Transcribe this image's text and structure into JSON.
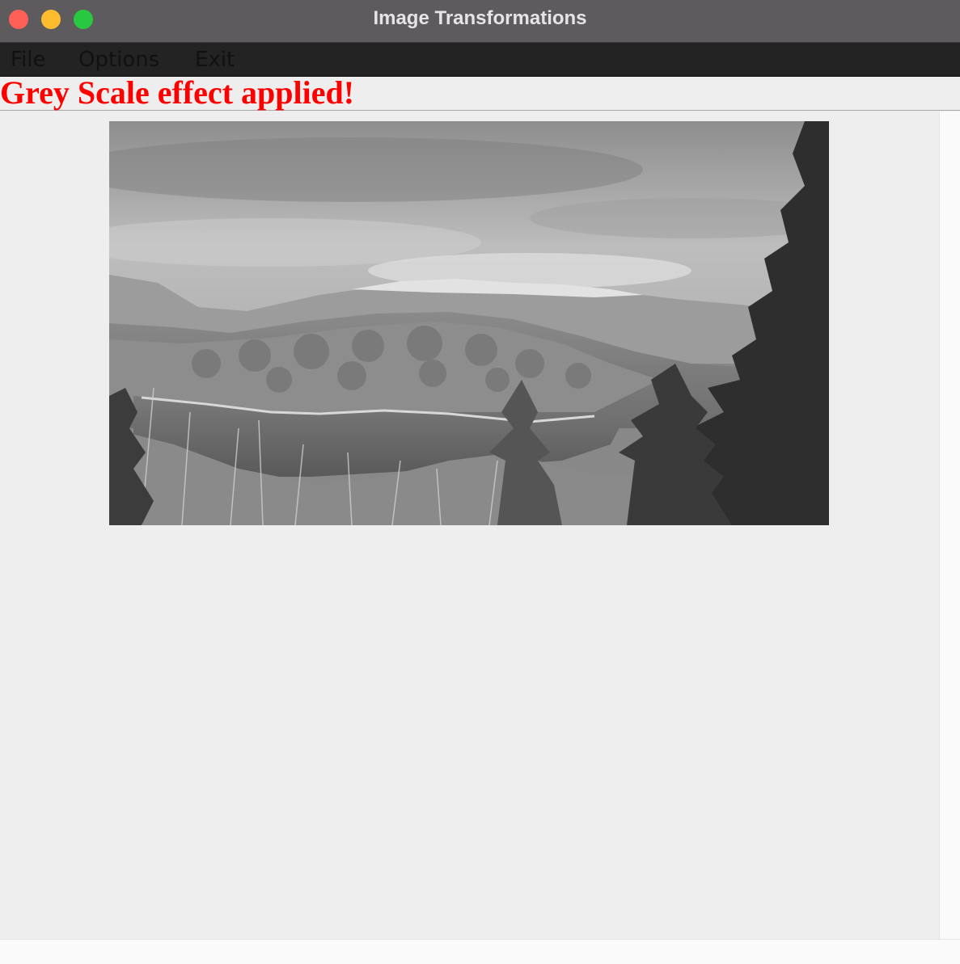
{
  "window": {
    "title": "Image Transformations"
  },
  "menubar": {
    "items": [
      {
        "label": "File"
      },
      {
        "label": "Options"
      },
      {
        "label": "Exit"
      }
    ]
  },
  "status": {
    "message": "Grey Scale effect applied!",
    "color": "#ff0000"
  },
  "image": {
    "effect": "greyscale",
    "subject": "landscape photo"
  },
  "colors": {
    "titlebar": "#5e5b5f",
    "menubar": "#232323",
    "panel": "#eeeeee",
    "close": "#fe5f57",
    "minimize": "#febc2e",
    "maximize": "#28c840"
  }
}
